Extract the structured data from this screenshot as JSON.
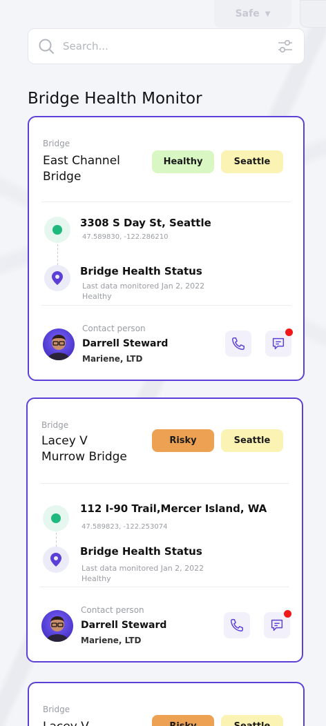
{
  "top_bar": {
    "dropdown_label": "Safe"
  },
  "search": {
    "placeholder": "Search..."
  },
  "page_title": "Bridge Health Monitor",
  "colors": {
    "accent": "#5b3fd6",
    "healthy": "#d8f7c2",
    "risky": "#eda153",
    "city": "#fbf3b4",
    "green_dot": "#1fb87d",
    "notification": "#f01818"
  },
  "cards": [
    {
      "label": "Bridge",
      "name_line1": "East Channel",
      "name_line2": "Bridge",
      "status_badge": "Healthy",
      "city_badge": "Seattle",
      "address": "3308 S Day St, Seattle",
      "coordinates": "47.589830, -122.286210",
      "health_title": "Bridge Health Status",
      "last_monitored": "Last data monitored Jan 2, 2022",
      "health_value": "Healthy",
      "contact_label": "Contact person",
      "contact_name": "Darrell Steward",
      "contact_company": "Mariene, LTD"
    },
    {
      "label": "Bridge",
      "name_line1": "Lacey V",
      "name_line2": "Murrow Bridge",
      "status_badge": "Risky",
      "city_badge": "Seattle",
      "address": "112 I-90 Trail,Mercer Island, WA",
      "coordinates": "47.589823, -122.253074",
      "health_title": "Bridge Health Status",
      "last_monitored": "Last data monitored Jan 2, 2022",
      "health_value": "Healthy",
      "contact_label": "Contact person",
      "contact_name": "Darrell Steward",
      "contact_company": "Mariene, LTD"
    },
    {
      "label": "Bridge",
      "name_line1": "Lacey V",
      "status_badge": "Risky",
      "city_badge": "Seattle"
    }
  ]
}
